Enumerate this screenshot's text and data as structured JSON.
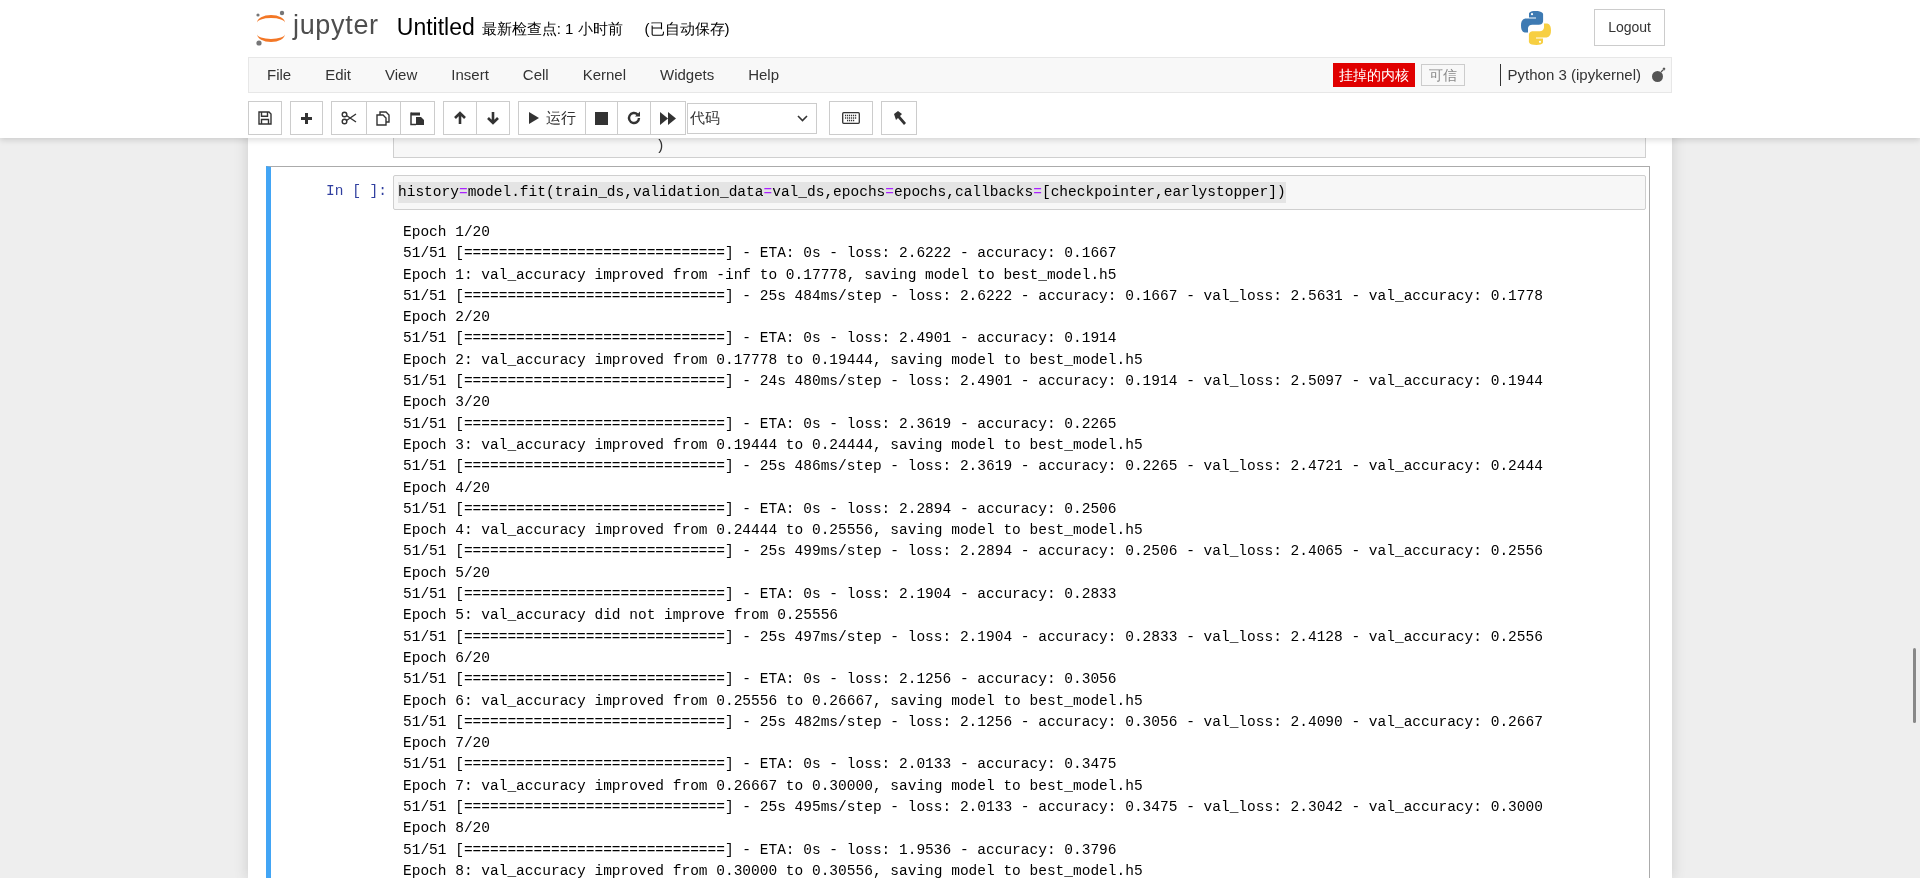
{
  "header": {
    "logo_text": "jupyter",
    "notebook_title": "Untitled",
    "checkpoint": "最新检查点: 1 小时前",
    "autosave": "(已自动保存)",
    "logout": "Logout"
  },
  "menu": [
    "File",
    "Edit",
    "View",
    "Insert",
    "Cell",
    "Kernel",
    "Widgets",
    "Help"
  ],
  "notifications": {
    "kernel_message": "挂掉的内核",
    "trusted": "可信"
  },
  "kernel": {
    "name": "Python 3 (ipykernel)",
    "dead": true
  },
  "toolbar": {
    "run_label": "运行",
    "cell_type": "代码"
  },
  "previous_cell": {
    "visible_text": ")"
  },
  "cell": {
    "prompt": "In [ ]:",
    "selected": true,
    "code": [
      {
        "text": "history",
        "kind": "name"
      },
      {
        "text": "=",
        "kind": "operator"
      },
      {
        "text": "model.fit(train_ds,validation_data",
        "kind": "name"
      },
      {
        "text": "=",
        "kind": "operator"
      },
      {
        "text": "val_ds,epochs",
        "kind": "name"
      },
      {
        "text": "=",
        "kind": "operator"
      },
      {
        "text": "epochs,callbacks",
        "kind": "name"
      },
      {
        "text": "=",
        "kind": "operator"
      },
      {
        "text": "[checkpointer,earlystopper])",
        "kind": "name"
      }
    ],
    "output": [
      "Epoch 1/20",
      "51/51 [==============================] - ETA: 0s - loss: 2.6222 - accuracy: 0.1667",
      "Epoch 1: val_accuracy improved from -inf to 0.17778, saving model to best_model.h5",
      "51/51 [==============================] - 25s 484ms/step - loss: 2.6222 - accuracy: 0.1667 - val_loss: 2.5631 - val_accuracy: 0.1778",
      "Epoch 2/20",
      "51/51 [==============================] - ETA: 0s - loss: 2.4901 - accuracy: 0.1914",
      "Epoch 2: val_accuracy improved from 0.17778 to 0.19444, saving model to best_model.h5",
      "51/51 [==============================] - 24s 480ms/step - loss: 2.4901 - accuracy: 0.1914 - val_loss: 2.5097 - val_accuracy: 0.1944",
      "Epoch 3/20",
      "51/51 [==============================] - ETA: 0s - loss: 2.3619 - accuracy: 0.2265",
      "Epoch 3: val_accuracy improved from 0.19444 to 0.24444, saving model to best_model.h5",
      "51/51 [==============================] - 25s 486ms/step - loss: 2.3619 - accuracy: 0.2265 - val_loss: 2.4721 - val_accuracy: 0.2444",
      "Epoch 4/20",
      "51/51 [==============================] - ETA: 0s - loss: 2.2894 - accuracy: 0.2506",
      "Epoch 4: val_accuracy improved from 0.24444 to 0.25556, saving model to best_model.h5",
      "51/51 [==============================] - 25s 499ms/step - loss: 2.2894 - accuracy: 0.2506 - val_loss: 2.4065 - val_accuracy: 0.2556",
      "Epoch 5/20",
      "51/51 [==============================] - ETA: 0s - loss: 2.1904 - accuracy: 0.2833",
      "Epoch 5: val_accuracy did not improve from 0.25556",
      "51/51 [==============================] - 25s 497ms/step - loss: 2.1904 - accuracy: 0.2833 - val_loss: 2.4128 - val_accuracy: 0.2556",
      "Epoch 6/20",
      "51/51 [==============================] - ETA: 0s - loss: 2.1256 - accuracy: 0.3056",
      "Epoch 6: val_accuracy improved from 0.25556 to 0.26667, saving model to best_model.h5",
      "51/51 [==============================] - 25s 482ms/step - loss: 2.1256 - accuracy: 0.3056 - val_loss: 2.4090 - val_accuracy: 0.2667",
      "Epoch 7/20",
      "51/51 [==============================] - ETA: 0s - loss: 2.0133 - accuracy: 0.3475",
      "Epoch 7: val_accuracy improved from 0.26667 to 0.30000, saving model to best_model.h5",
      "51/51 [==============================] - 25s 495ms/step - loss: 2.0133 - accuracy: 0.3475 - val_loss: 2.3042 - val_accuracy: 0.3000",
      "Epoch 8/20",
      "51/51 [==============================] - ETA: 0s - loss: 1.9536 - accuracy: 0.3796",
      "Epoch 8: val_accuracy improved from 0.30000 to 0.30556, saving model to best_model.h5"
    ]
  }
}
